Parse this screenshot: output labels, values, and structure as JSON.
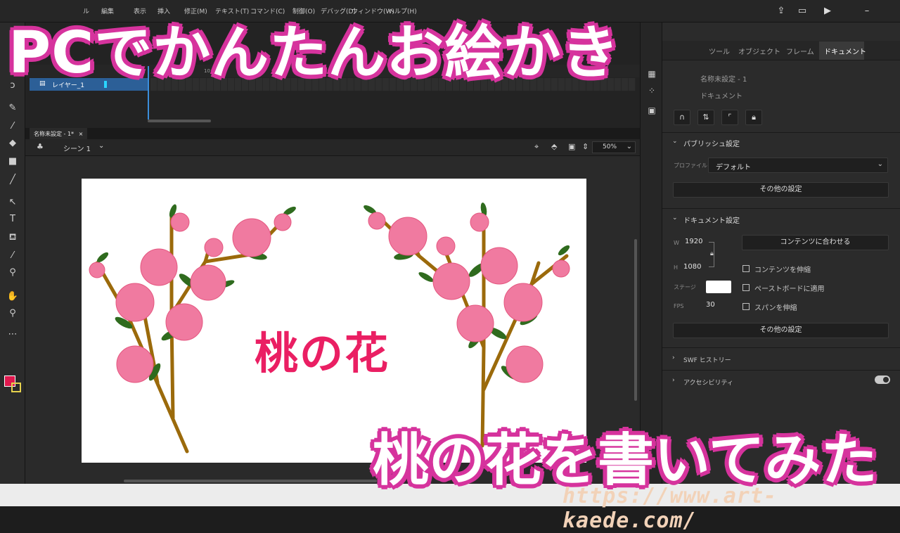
{
  "menubar": {
    "menus": [
      "ル",
      "編集",
      "表示",
      "挿入",
      "修正(M)",
      "テキスト(T)",
      "コマンド(C)",
      "制御(O)",
      "デバッグ(D)",
      "ウィンドウ(W)",
      "ヘルプ(H)"
    ]
  },
  "timeline": {
    "layer_name": "レイヤー_1",
    "frame_marker": "10"
  },
  "document": {
    "tab_label": "名称未設定 - 1*",
    "tab_close": "×",
    "scene_label": "シーン 1",
    "zoom": "50%"
  },
  "stage": {
    "title_text": "桃の花",
    "title_color": "#ea1f63",
    "background": "#ffffff"
  },
  "properties": {
    "tabs": [
      "ツール",
      "オブジェクト",
      "フレーム",
      "ドキュメント"
    ],
    "active_tab": "ドキュメント",
    "doc_name": "名称未設定 - 1",
    "doc_type": "ドキュメント",
    "publish": {
      "heading": "パブリッシュ設定",
      "profile_label": "プロファイル",
      "profile_value": "デフォルト",
      "more_button": "その他の設定"
    },
    "doc_settings": {
      "heading": "ドキュメント設定",
      "w_label": "W",
      "w_value": "1920",
      "h_label": "H",
      "h_value": "1080",
      "fit_button": "コンテンツに合わせる",
      "scale_content": "コンテンツを伸縮",
      "stage_label": "ステージ",
      "apply_pasteboard": "ペーストボードに適用",
      "fps_label": "FPS",
      "fps_value": "30",
      "scale_spans": "スパンを伸縮",
      "more_button": "その他の設定"
    },
    "swf_history": "SWF ヒストリー",
    "accessibility": "アクセシビリティ"
  },
  "overlay": {
    "caption_top": "PCでかんたんお絵かき",
    "caption_bottom": "桃の花を書いてみた",
    "caption_color": "#d6339d",
    "watermark_url": "https://www.art-kaede.com/"
  }
}
